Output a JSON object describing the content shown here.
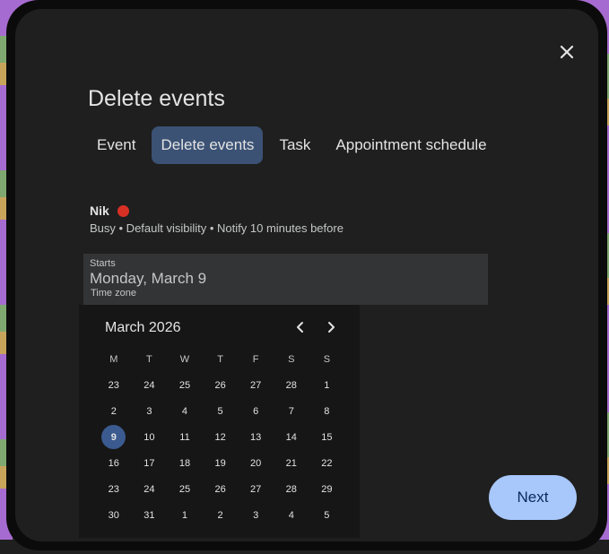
{
  "dialog": {
    "title": "Delete events",
    "close_icon": "close-icon"
  },
  "tabs": [
    {
      "label": "Event",
      "active": false
    },
    {
      "label": "Delete events",
      "active": true
    },
    {
      "label": "Task",
      "active": false
    },
    {
      "label": "Appointment schedule",
      "active": false
    }
  ],
  "owner": {
    "name": "Nik",
    "color": "#d93025",
    "meta": "Busy • Default visibility • Notify 10 minutes before"
  },
  "start": {
    "label": "Starts",
    "value": "Monday, March 9",
    "timezone_label": "Time zone"
  },
  "datepicker": {
    "month_label": "March 2026",
    "prev_icon": "chevron-left-icon",
    "next_icon": "chevron-right-icon",
    "weekdays": [
      "M",
      "T",
      "W",
      "T",
      "F",
      "S",
      "S"
    ],
    "weeks": [
      [
        "23",
        "24",
        "25",
        "26",
        "27",
        "28",
        "1"
      ],
      [
        "2",
        "3",
        "4",
        "5",
        "6",
        "7",
        "8"
      ],
      [
        "9",
        "10",
        "11",
        "12",
        "13",
        "14",
        "15"
      ],
      [
        "16",
        "17",
        "18",
        "19",
        "20",
        "21",
        "22"
      ],
      [
        "23",
        "24",
        "25",
        "26",
        "27",
        "28",
        "29"
      ],
      [
        "30",
        "31",
        "1",
        "2",
        "3",
        "4",
        "5"
      ]
    ],
    "selected_day": "9",
    "selected_color": "#3b5a8f"
  },
  "footer": {
    "next_label": "Next",
    "accent": "#a8c7fa"
  }
}
